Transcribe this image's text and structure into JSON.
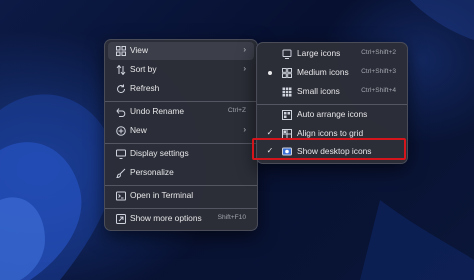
{
  "context_menu": {
    "items": [
      {
        "label": "View",
        "icon": "grid-icon",
        "submenu": true
      },
      {
        "label": "Sort by",
        "icon": "sort-icon",
        "submenu": true
      },
      {
        "label": "Refresh",
        "icon": "refresh-icon"
      },
      {
        "label": "Undo Rename",
        "icon": "undo-icon",
        "shortcut": "Ctrl+Z"
      },
      {
        "label": "New",
        "icon": "plus-circle-icon",
        "submenu": true
      },
      {
        "label": "Display settings",
        "icon": "display-icon"
      },
      {
        "label": "Personalize",
        "icon": "brush-icon"
      },
      {
        "label": "Open in Terminal",
        "icon": "terminal-icon"
      },
      {
        "label": "Show more options",
        "icon": "more-options-icon",
        "shortcut": "Shift+F10"
      }
    ]
  },
  "view_submenu": {
    "items": [
      {
        "label": "Large icons",
        "icon": "large-icons-icon",
        "shortcut": "Ctrl+Shift+2"
      },
      {
        "label": "Medium icons",
        "icon": "medium-icons-icon",
        "shortcut": "Ctrl+Shift+3",
        "selected": true
      },
      {
        "label": "Small icons",
        "icon": "small-icons-icon",
        "shortcut": "Ctrl+Shift+4"
      },
      {
        "label": "Auto arrange icons",
        "icon": "auto-arrange-icon"
      },
      {
        "label": "Align icons to grid",
        "icon": "align-grid-icon",
        "checked": true
      },
      {
        "label": "Show desktop icons",
        "icon": "show-desktop-icon",
        "checked": true,
        "highlighted": true
      }
    ]
  },
  "colors": {
    "menu_bg": "#2c2e38",
    "highlight_border": "#d4161c",
    "desktop_bg": "#0a1430"
  }
}
